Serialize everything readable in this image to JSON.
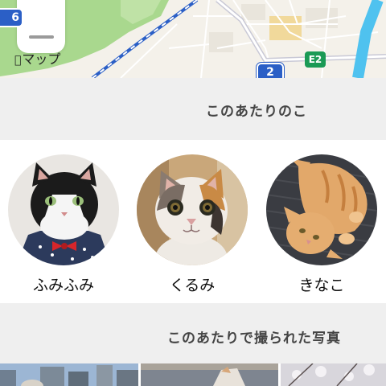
{
  "map": {
    "app_label": "マップ",
    "route_badge": "2",
    "route_badge_partial": "6",
    "expressway_badge": "E2",
    "colors": {
      "road_blue": "#2b5fc6",
      "expressway_green": "#1a9a55",
      "park_green": "#a9d88e",
      "water": "#4fc2ef"
    }
  },
  "nearby_section": {
    "title": "このあたりのこ"
  },
  "cats": [
    {
      "name": "ふみふみ"
    },
    {
      "name": "くるみ"
    },
    {
      "name": "きなこ"
    }
  ],
  "photos_section": {
    "title": "このあたりで撮られた写真"
  }
}
